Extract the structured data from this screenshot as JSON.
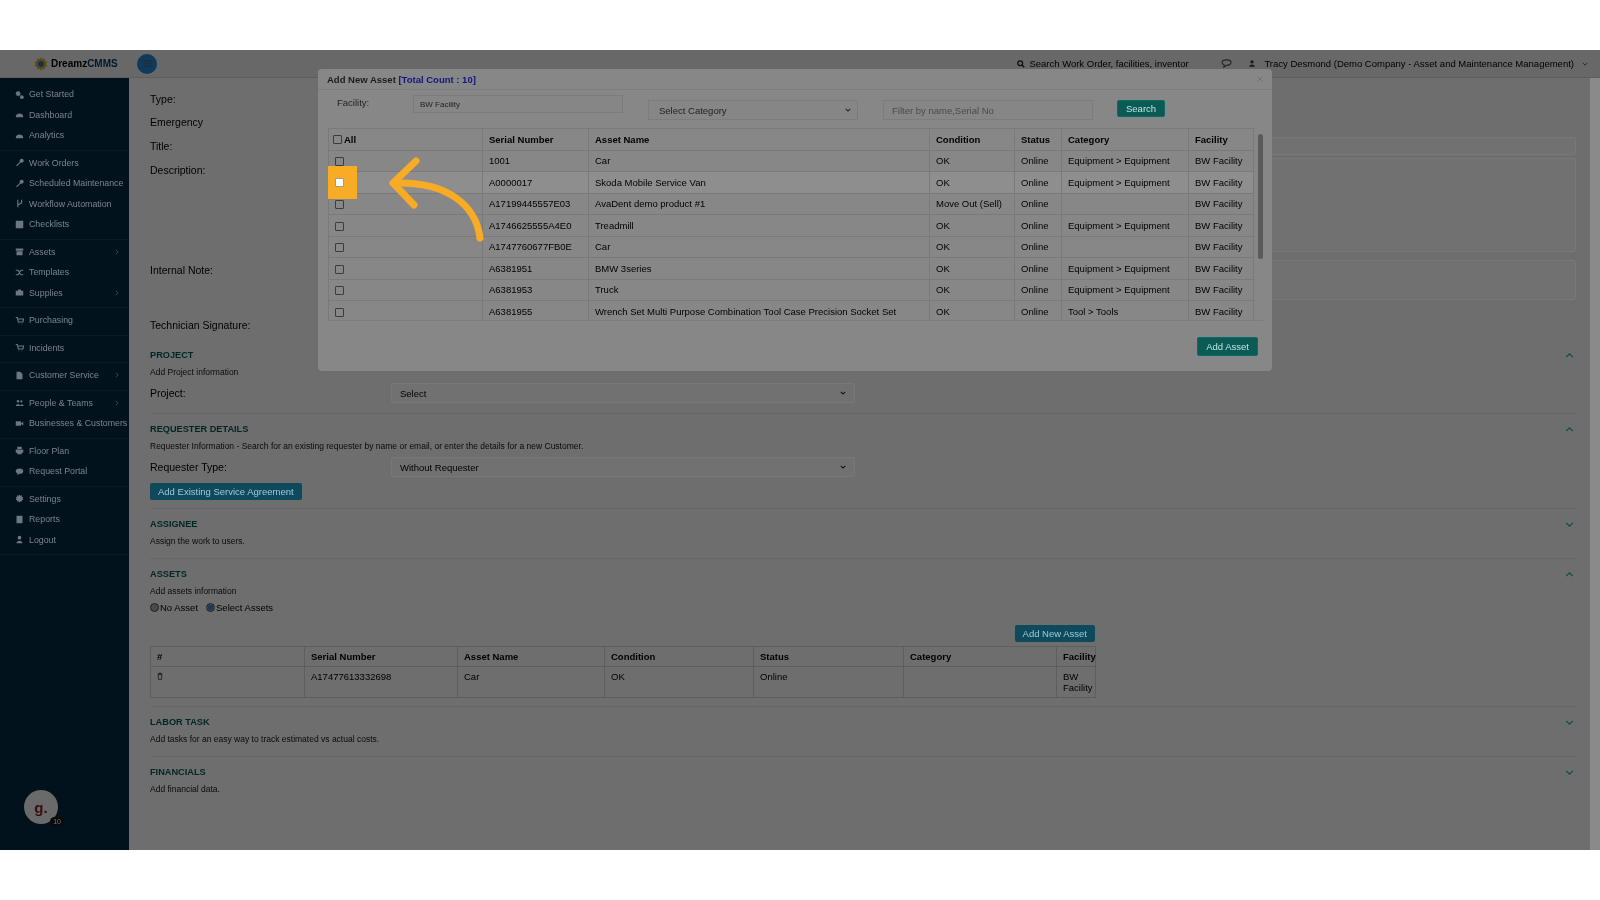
{
  "topbar": {
    "logo_first": "Dreamz",
    "logo_second": "CMMS",
    "search_placeholder": "Search Work Order, facilities, inventor",
    "user": "Tracy Desmond (Demo Company - Asset and Maintenance Management)"
  },
  "sidebar": {
    "groups": [
      [
        {
          "label": "Get Started",
          "kind": "gears",
          "submenu": false
        },
        {
          "label": "Dashboard",
          "kind": "gauge",
          "submenu": false
        },
        {
          "label": "Analytics",
          "kind": "gauge",
          "submenu": false
        }
      ],
      [
        {
          "label": "Work Orders",
          "kind": "wrench",
          "submenu": false
        },
        {
          "label": "Scheduled Maintenance",
          "kind": "wrench",
          "submenu": false
        },
        {
          "label": "Workflow Automation",
          "kind": "branch",
          "submenu": false
        },
        {
          "label": "Checklists",
          "kind": "check",
          "submenu": false
        }
      ],
      [
        {
          "label": "Assets",
          "kind": "box",
          "submenu": true
        },
        {
          "label": "Templates",
          "kind": "shuffle",
          "submenu": false
        },
        {
          "label": "Supplies",
          "kind": "briefcase",
          "submenu": true
        }
      ],
      [
        {
          "label": "Purchasing",
          "kind": "cart",
          "submenu": false
        }
      ],
      [
        {
          "label": "Incidents",
          "kind": "cart",
          "submenu": false
        }
      ],
      [
        {
          "label": "Customer Service",
          "kind": "file",
          "submenu": true
        }
      ],
      [
        {
          "label": "People & Teams",
          "kind": "users",
          "submenu": true
        },
        {
          "label": "Businesses & Customers",
          "kind": "video",
          "submenu": false
        }
      ],
      [
        {
          "label": "Floor Plan",
          "kind": "print",
          "submenu": false
        },
        {
          "label": "Request Portal",
          "kind": "comment",
          "submenu": false
        }
      ],
      [
        {
          "label": "Settings",
          "kind": "gear",
          "submenu": false
        },
        {
          "label": "Reports",
          "kind": "doc",
          "submenu": false
        },
        {
          "label": "Logout",
          "kind": "user",
          "submenu": false
        }
      ]
    ]
  },
  "avatar": {
    "initial": "g.",
    "badge": "10"
  },
  "form": {
    "type_label": "Type:",
    "type_value": "Emergency",
    "title_label": "Title:",
    "description_label": "Description:",
    "note_label": "Internal Note:",
    "signature_label": "Technician Signature:"
  },
  "project": {
    "title": "PROJECT",
    "subtitle": "Add Project information",
    "expanded": true,
    "label": "Project:",
    "select": "Select"
  },
  "requester": {
    "title": "REQUESTER DETAILS",
    "subtitle": "Requester Information - Search for an existing requester by name or email, or enter the details for a new Customer.",
    "expanded": true,
    "label": "Requester Type:",
    "select": "Without Requester",
    "button": "Add Existing Service Agreement"
  },
  "assignee": {
    "title": "ASSIGNEE",
    "subtitle": "Assign the work to users.",
    "expanded": false
  },
  "assets": {
    "title": "ASSETS",
    "subtitle": "Add assets information",
    "expanded": true,
    "options": [
      {
        "label": "No Asset",
        "selected": false
      },
      {
        "label": "Select Assets",
        "selected": true
      }
    ],
    "add_button": "Add New Asset",
    "columns": [
      "#",
      "Serial Number",
      "Asset Name",
      "Condition",
      "Status",
      "Category",
      "Facility"
    ],
    "rows": [
      {
        "cells": [
          "",
          "A17477613332698",
          "Car",
          "OK",
          "Online",
          "",
          "BW Facility"
        ]
      }
    ]
  },
  "labor": {
    "title": "LABOR TASK",
    "subtitle": "Add tasks for an easy way to track estimated vs actual costs.",
    "expanded": false
  },
  "financials": {
    "title": "FINANCIALS",
    "subtitle": "Add financial data.",
    "expanded": false
  },
  "modal": {
    "title": "Add New Asset",
    "count": "[Total Count : 10]",
    "facility_label": "Facility:",
    "facility_value": "BW Facility",
    "category_select": "Select Category",
    "filter_placeholder": "Filter by name,Serial No",
    "search_button": "Search",
    "all_label": "All",
    "all_checked": false,
    "columns": [
      "Serial Number",
      "Asset Name",
      "Condition",
      "Status",
      "Category",
      "Facility"
    ],
    "rows": [
      {
        "checked": false,
        "highlighted": false,
        "cells": [
          "1001",
          "Car",
          "OK",
          "Online",
          "Equipment > Equipment",
          "BW Facility"
        ]
      },
      {
        "checked": false,
        "highlighted": true,
        "cells": [
          "A0000017",
          "Skoda Mobile Service Van",
          "OK",
          "Online",
          "Equipment > Equipment",
          "BW Facility"
        ]
      },
      {
        "checked": false,
        "highlighted": false,
        "cells": [
          "A17199445557E03",
          "AvaDent demo product #1",
          "Move Out (Sell)",
          "Online",
          "",
          "BW Facility"
        ]
      },
      {
        "checked": false,
        "highlighted": false,
        "cells": [
          "A1746625555A4E0",
          "Treadmill",
          "OK",
          "Online",
          "Equipment > Equipment",
          "BW Facility"
        ]
      },
      {
        "checked": false,
        "highlighted": false,
        "cells": [
          "A1747760677FB0E",
          "Car",
          "OK",
          "Online",
          "",
          "BW Facility"
        ]
      },
      {
        "checked": false,
        "highlighted": false,
        "cells": [
          "A6381951",
          "BMW 3series",
          "OK",
          "Online",
          "Equipment > Equipment",
          "BW Facility"
        ]
      },
      {
        "checked": false,
        "highlighted": false,
        "cells": [
          "A6381953",
          "Truck",
          "OK",
          "Online",
          "Equipment > Equipment",
          "BW Facility"
        ]
      },
      {
        "checked": false,
        "highlighted": false,
        "cells": [
          "A6381955",
          "Wrench Set Multi Purpose Combination Tool Case Precision Socket Set",
          "OK",
          "Online",
          "Tool > Tools",
          "BW Facility"
        ]
      }
    ],
    "add_button": "Add Asset"
  }
}
